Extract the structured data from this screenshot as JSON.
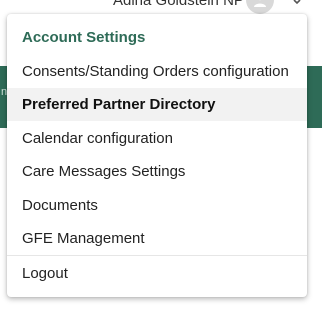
{
  "header": {
    "user_name": "Adina Goldstein NP"
  },
  "menu": {
    "header_label": "Account Settings",
    "items": [
      {
        "label": "Consents/Standing Orders configuration",
        "active": false
      },
      {
        "label": "Preferred Partner Directory",
        "active": true
      },
      {
        "label": "Calendar configuration",
        "active": false
      },
      {
        "label": "Care Messages Settings",
        "active": false
      },
      {
        "label": "Documents",
        "active": false
      },
      {
        "label": "GFE Management",
        "active": false
      }
    ],
    "logout_label": "Logout"
  },
  "colors": {
    "accent": "#2e6b57",
    "hover_bg": "#f2f2f2"
  },
  "icons": {
    "avatar": "user-avatar-icon",
    "dropdown": "chevron-down-icon"
  }
}
